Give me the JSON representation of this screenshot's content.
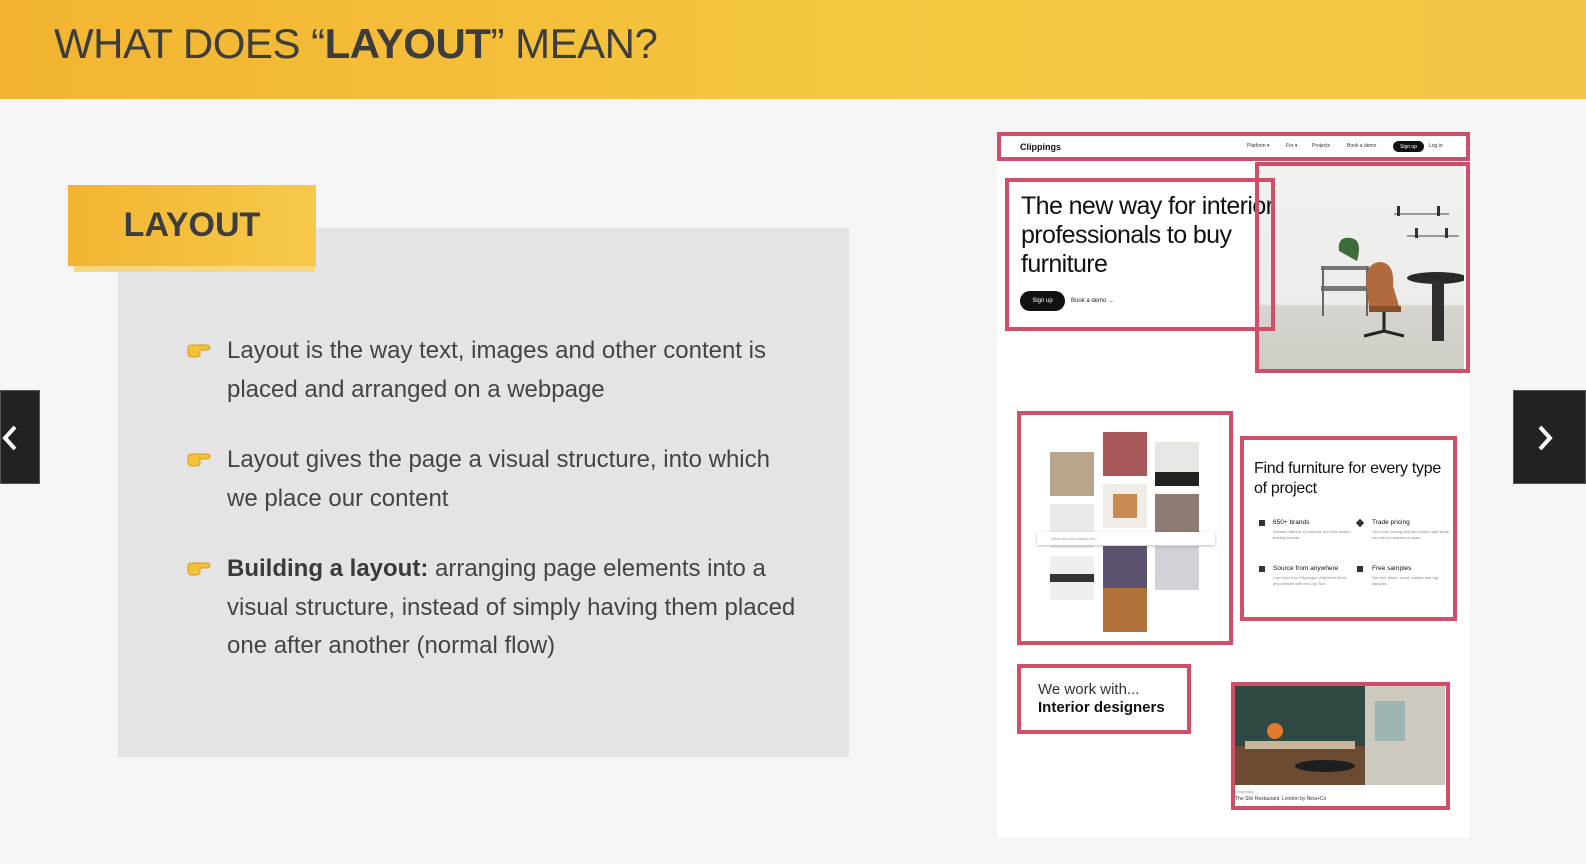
{
  "slide": {
    "title_pre": "WHAT DOES “",
    "title_bold": "LAYOUT",
    "title_post": "” MEAN?",
    "tag": "LAYOUT",
    "bullets": [
      {
        "text": "Layout is the way text, images and other content is placed and arranged on a webpage"
      },
      {
        "text": "Layout gives the page a visual structure, into which we place our content"
      },
      {
        "bold": "Building a layout:",
        "text": " arranging page elements into a visual structure, instead of simply having them placed one after another (normal flow)"
      }
    ]
  },
  "colors": {
    "header": "#f4bf3c",
    "highlight": "#cf4f68",
    "box": "#e4e4e4"
  },
  "icons": {
    "bullet": "pointing-hand-icon",
    "prev": "chevron-left-icon",
    "next": "chevron-right-icon"
  },
  "mock": {
    "logo": "Clippings",
    "nav": [
      "Platform ▾",
      "For ▾",
      "Projects",
      "Book a demo"
    ],
    "nav_signup": "Sign up",
    "nav_login": "Log in",
    "hero": "The new way for interior professionals to buy furniture",
    "hero_btn": "Sign up",
    "hero_link": "Book a demo →",
    "search_placeholder": "What are you looking for?",
    "find_title": "Find furniture for every type of project",
    "features": [
      {
        "title": "650+ brands",
        "text": "Browse millions of products from the world's leading brands"
      },
      {
        "title": "Trade pricing",
        "text": "See trade pricing and lead times right away. No need to request a quote."
      },
      {
        "title": "Source from anywhere",
        "text": "Can't find it on Clippings? Add items from any website with the Clip Tool"
      },
      {
        "title": "Free samples",
        "text": "Get free fabric, wood, marble and rug samples."
      }
    ],
    "work_line1": "We work with...",
    "work_line2": "Interior designers",
    "caption_cat": "Hospitality",
    "caption": "The Silo Restaurant, London by Nina+Co"
  }
}
